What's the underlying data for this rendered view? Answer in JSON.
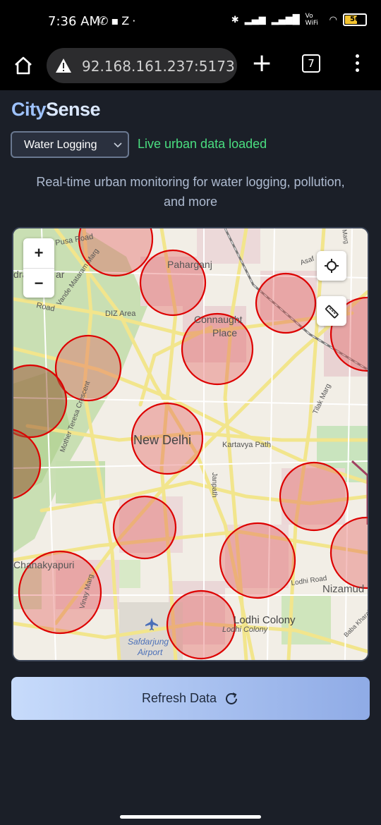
{
  "status_bar": {
    "time": "7:36 AM",
    "left_icons": [
      "whatsapp-icon",
      "notification-icon",
      "z-icon",
      "dot-icon"
    ],
    "battery": "56",
    "network_label": "Vo WiFi"
  },
  "browser": {
    "url": "92.168.161.237:5173",
    "tab_count": "7"
  },
  "app": {
    "title_part1": "City",
    "title_part2": "Sense",
    "layer_selected": "Water Logging",
    "status_message": "Live urban data loaded",
    "subtitle": "Real-time urban monitoring for water logging, pollution, and more",
    "refresh_label": "Refresh Data"
  },
  "map": {
    "labels": {
      "pusa_road": "Pusa Road",
      "paharganj": "Paharganj",
      "connaught": "Connaught",
      "place": "Place",
      "diz_area": "DIZ Area",
      "new_delhi": "New Delhi",
      "kartavya_path": "Kartavya Path",
      "janpath": "Janpath",
      "chanakyapuri": "Chanakyapuri",
      "vinay_marg": "Vinay Marg",
      "lodhi_colony": "Lodhi Colony",
      "lodhi_colony_small": "Lodhi Colony",
      "lodhi_road": "Lodhi Road",
      "nizamuddin": "Nizamud",
      "safdarjung": "Safdarjung",
      "airport": "Airport",
      "tilak_marg": "Tilak Marg",
      "vande_mataram": "Vande Mataram Marg",
      "mother_teresa": "Mother Teresa Crescent",
      "road_left": "Road",
      "dra": "dra",
      "ar": "ar",
      "asaf": "Asaf",
      "baba_kharak": "Baba Kharak",
      "marg_top": "Marg"
    },
    "zoom_in": "+",
    "zoom_out": "−",
    "circle_color": "#dd0000",
    "circle_fill": "#e25a5a"
  }
}
